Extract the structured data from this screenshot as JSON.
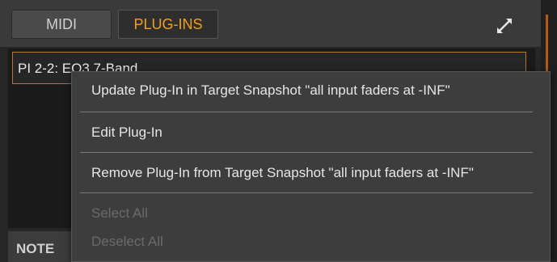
{
  "tabs": [
    {
      "label": "MIDI"
    },
    {
      "label": "PLUG-INS"
    }
  ],
  "plugin_row": {
    "label": "PI 2-2: EQ3 7-Band"
  },
  "notes": {
    "label": "NOTE"
  },
  "context_menu": {
    "items": [
      {
        "label": "Update Plug-In in Target Snapshot \"all input faders at -INF\"",
        "enabled": true
      },
      {
        "label": "Edit Plug-In",
        "enabled": true
      },
      {
        "label": "Remove Plug-In from Target Snapshot \"all input faders at -INF\"",
        "enabled": true
      },
      {
        "label": "Select All",
        "enabled": false
      },
      {
        "label": "Deselect All",
        "enabled": false
      }
    ]
  },
  "icons": {
    "expand": "expand-icon"
  },
  "colors": {
    "accent": "#f0a020",
    "row_border": "#b8752a"
  }
}
